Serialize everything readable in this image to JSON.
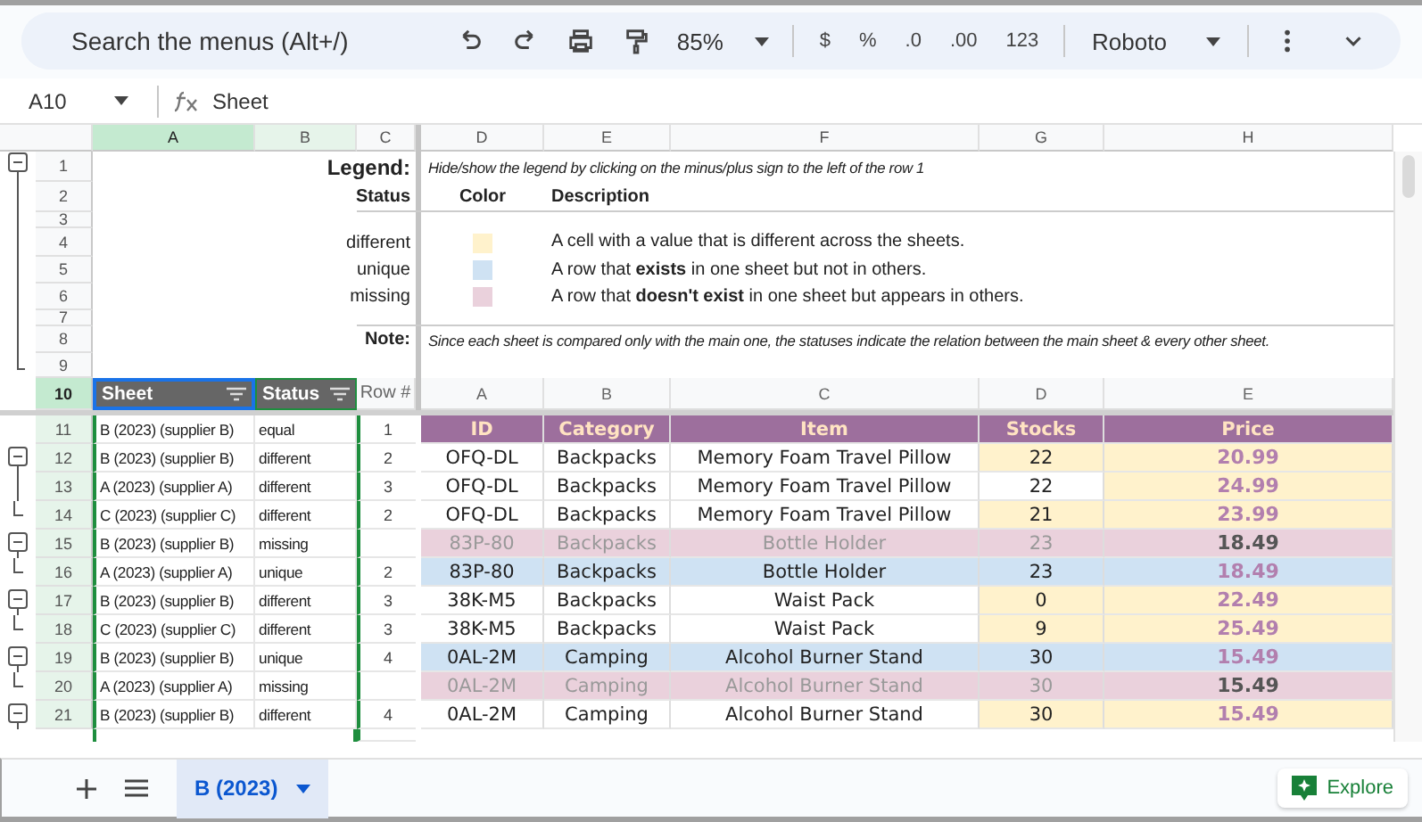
{
  "toolbar": {
    "search": {
      "placeholder": "Search the menus (Alt+/)"
    },
    "zoom": "85%",
    "format_buttons": [
      "$",
      "%",
      ".0",
      ".00",
      "123"
    ],
    "font": "Roboto"
  },
  "formula_bar": {
    "cell_ref": "A10",
    "value": "Sheet"
  },
  "frozen_columns": [
    {
      "label": "A",
      "selected": true
    },
    {
      "label": "B",
      "selected": false
    },
    {
      "label": "C",
      "selected": false
    }
  ],
  "columns": [
    {
      "label": "D"
    },
    {
      "label": "E"
    },
    {
      "label": "F"
    },
    {
      "label": "G"
    },
    {
      "label": "H"
    }
  ],
  "legend": {
    "title": "Legend:",
    "hint": "Hide/show the legend by clicking on the minus/plus sign to the left of the row 1",
    "status_header": "Status",
    "color_header": "Color",
    "description_header": "Description",
    "entries": [
      {
        "status": "different",
        "color": "#fff2cc",
        "description": "A cell with a value that is different across the sheets."
      },
      {
        "status": "unique",
        "color": "#cfe2f3",
        "description": "A row that **exists** in one sheet but not in others."
      },
      {
        "status": "missing",
        "color": "#ead1dc",
        "description": "A row that **doesn't exist** in one sheet but appears in others."
      }
    ],
    "note_label": "Note:",
    "note": "Since each sheet is compared only with the main one, the statuses indicate the relation between the main sheet & every other sheet."
  },
  "row_numbers": [
    "1",
    "2",
    "3",
    "4",
    "5",
    "6",
    "7",
    "8",
    "9",
    "10",
    "11",
    "12",
    "13",
    "14",
    "15",
    "16",
    "17",
    "18",
    "19",
    "20",
    "21"
  ],
  "header_row": {
    "sheet": "Sheet",
    "status": "Status",
    "row_no": "Row #",
    "cells": [
      "A",
      "B",
      "C",
      "D",
      "E"
    ],
    "selected": true
  },
  "table": {
    "columns": [
      "ID",
      "Category",
      "Item",
      "Stocks",
      "Price"
    ],
    "rows": [
      {
        "sheet": "B (2023) (supplier B)",
        "status": "equal",
        "row_no": "1",
        "kind": "heading",
        "in_group": false,
        "collapsible": false
      },
      {
        "sheet": "B (2023) (supplier B)",
        "status": "different",
        "row_no": "2",
        "kind": "different",
        "in_group": true,
        "collapsible": true,
        "cells": [
          {
            "text": "OFQ-DL",
            "changed": false
          },
          {
            "text": "Backpacks",
            "changed": false
          },
          {
            "text": "Memory Foam Travel Pillow",
            "changed": false
          },
          {
            "text": "22",
            "changed": true
          },
          {
            "text": "20.99",
            "changed": true
          }
        ]
      },
      {
        "sheet": "A (2023) (supplier A)",
        "status": "different",
        "row_no": "3",
        "kind": "different",
        "in_group": true,
        "collapsible": false,
        "cells": [
          {
            "text": "OFQ-DL",
            "changed": false
          },
          {
            "text": "Backpacks",
            "changed": false
          },
          {
            "text": "Memory Foam Travel Pillow",
            "changed": false
          },
          {
            "text": "22",
            "changed": false
          },
          {
            "text": "24.99",
            "changed": true
          }
        ]
      },
      {
        "sheet": "C (2023) (supplier C)",
        "status": "different",
        "row_no": "2",
        "kind": "different",
        "in_group": true,
        "collapsible": false,
        "cells": [
          {
            "text": "OFQ-DL",
            "changed": false
          },
          {
            "text": "Backpacks",
            "changed": false
          },
          {
            "text": "Memory Foam Travel Pillow",
            "changed": false
          },
          {
            "text": "21",
            "changed": true
          },
          {
            "text": "23.99",
            "changed": true
          }
        ]
      },
      {
        "sheet": "B (2023) (supplier B)",
        "status": "missing",
        "kind": "missing",
        "in_group": true,
        "collapsible": true,
        "cells": [
          {
            "text": "83P-80"
          },
          {
            "text": "Backpacks"
          },
          {
            "text": "Bottle Holder"
          },
          {
            "text": "23"
          },
          {
            "text": "18.49"
          }
        ]
      },
      {
        "sheet": "A (2023) (supplier A)",
        "status": "unique",
        "row_no": "2",
        "kind": "unique",
        "in_group": true,
        "collapsible": false,
        "cells": [
          {
            "text": "83P-80"
          },
          {
            "text": "Backpacks"
          },
          {
            "text": "Bottle Holder"
          },
          {
            "text": "23"
          },
          {
            "text": "18.49"
          }
        ]
      },
      {
        "sheet": "B (2023) (supplier B)",
        "status": "different",
        "row_no": "3",
        "kind": "different",
        "in_group": true,
        "collapsible": true,
        "cells": [
          {
            "text": "38K-M5",
            "changed": false
          },
          {
            "text": "Backpacks",
            "changed": false
          },
          {
            "text": "Waist Pack",
            "changed": false
          },
          {
            "text": "0",
            "changed": true
          },
          {
            "text": "22.49",
            "changed": true
          }
        ]
      },
      {
        "sheet": "C (2023) (supplier C)",
        "status": "different",
        "row_no": "3",
        "kind": "different",
        "in_group": true,
        "collapsible": false,
        "cells": [
          {
            "text": "38K-M5",
            "changed": false
          },
          {
            "text": "Backpacks",
            "changed": false
          },
          {
            "text": "Waist Pack",
            "changed": false
          },
          {
            "text": "9",
            "changed": true
          },
          {
            "text": "25.49",
            "changed": true
          }
        ]
      },
      {
        "sheet": "B (2023) (supplier B)",
        "status": "unique",
        "row_no": "4",
        "kind": "unique",
        "in_group": true,
        "collapsible": true,
        "cells": [
          {
            "text": "0AL-2M"
          },
          {
            "text": "Camping"
          },
          {
            "text": "Alcohol Burner Stand"
          },
          {
            "text": "30"
          },
          {
            "text": "15.49"
          }
        ]
      },
      {
        "sheet": "A (2023) (supplier A)",
        "status": "missing",
        "kind": "missing",
        "in_group": true,
        "collapsible": false,
        "cells": [
          {
            "text": "0AL-2M"
          },
          {
            "text": "Camping"
          },
          {
            "text": "Alcohol Burner Stand"
          },
          {
            "text": "30"
          },
          {
            "text": "15.49"
          }
        ]
      },
      {
        "sheet": "B (2023) (supplier B)",
        "status": "different",
        "row_no": "4",
        "kind": "different",
        "in_group": true,
        "collapsible": true,
        "cells": [
          {
            "text": "0AL-2M",
            "changed": false
          },
          {
            "text": "Camping",
            "changed": false
          },
          {
            "text": "Alcohol Burner Stand",
            "changed": false
          },
          {
            "text": "30",
            "changed": true
          },
          {
            "text": "15.49",
            "changed": true
          }
        ]
      }
    ]
  },
  "sheet_tabs": [
    {
      "label": "B (2023)",
      "selected": true
    }
  ],
  "explore": "Explore"
}
